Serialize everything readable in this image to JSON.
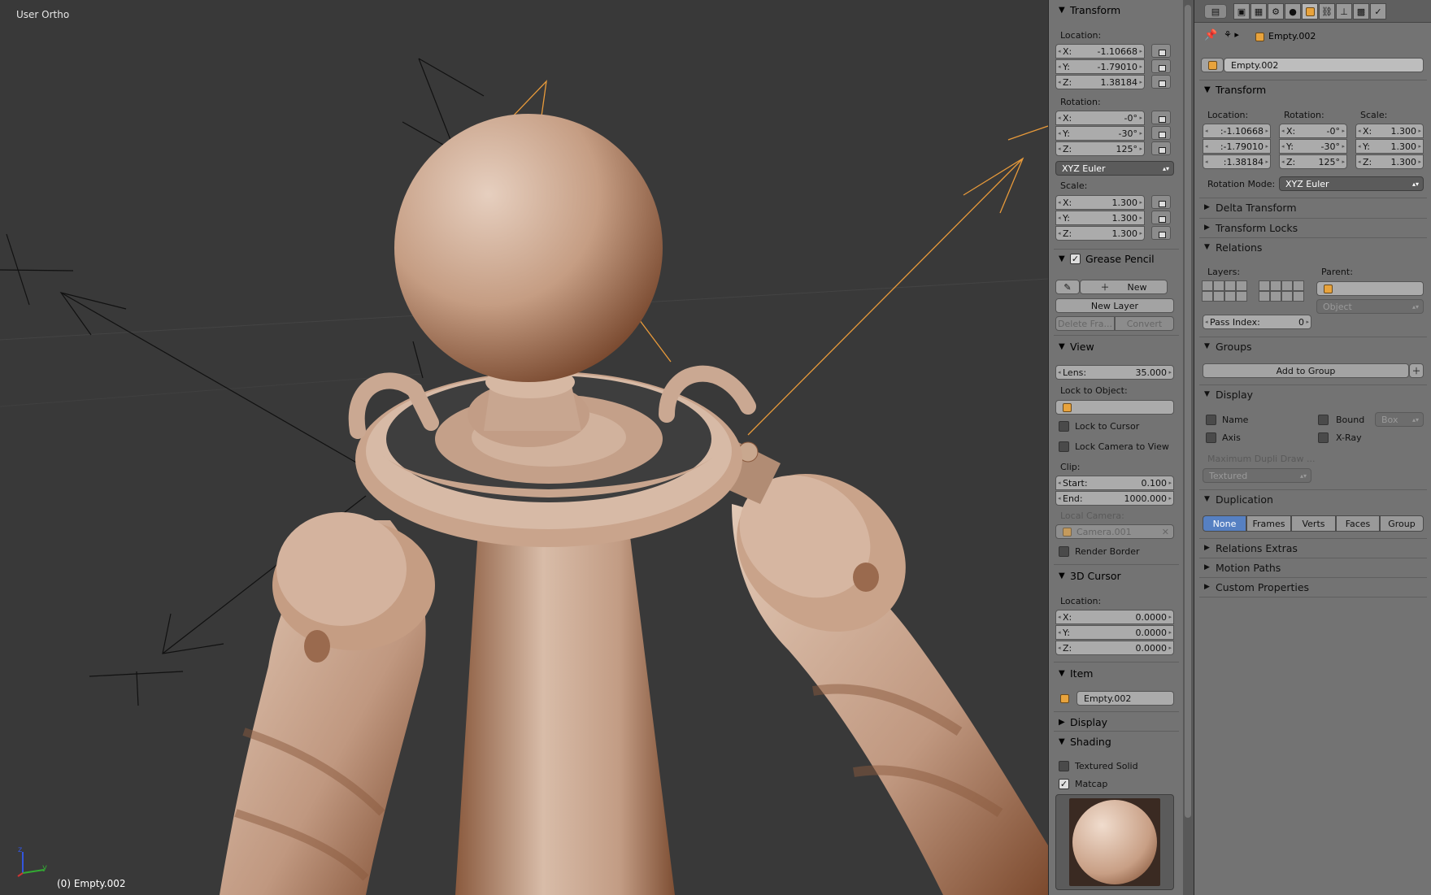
{
  "viewport": {
    "title": "User Ortho",
    "status": "(0) Empty.002",
    "axis_y": "y",
    "axis_z": "z"
  },
  "npanel": {
    "transform": {
      "header": "Transform",
      "location_label": "Location:",
      "location": [
        {
          "k": "X:",
          "v": "-1.10668"
        },
        {
          "k": "Y:",
          "v": "-1.79010"
        },
        {
          "k": "Z:",
          "v": "1.38184"
        }
      ],
      "rotation_label": "Rotation:",
      "rotation": [
        {
          "k": "X:",
          "v": "-0°"
        },
        {
          "k": "Y:",
          "v": "-30°"
        },
        {
          "k": "Z:",
          "v": "125°"
        }
      ],
      "rotation_mode": "XYZ Euler",
      "scale_label": "Scale:",
      "scale": [
        {
          "k": "X:",
          "v": "1.300"
        },
        {
          "k": "Y:",
          "v": "1.300"
        },
        {
          "k": "Z:",
          "v": "1.300"
        }
      ]
    },
    "grease_pencil": {
      "header": "Grease Pencil",
      "enabled": true,
      "new": "New",
      "new_layer": "New Layer",
      "delete_frame": "Delete Fra...",
      "convert": "Convert"
    },
    "view": {
      "header": "View",
      "lens_key": "Lens:",
      "lens_value": "35.000",
      "lock_to_object": "Lock to Object:",
      "lock_to_cursor": "Lock to Cursor",
      "lock_camera_to_view": "Lock Camera to View",
      "clip_label": "Clip:",
      "start_key": "Start:",
      "start_value": "0.100",
      "end_key": "End:",
      "end_value": "1000.000",
      "local_camera": "Local Camera:",
      "camera_name": "Camera.001",
      "render_border": "Render Border"
    },
    "cursor": {
      "header": "3D Cursor",
      "location_label": "Location:",
      "location": [
        {
          "k": "X:",
          "v": "0.0000"
        },
        {
          "k": "Y:",
          "v": "0.0000"
        },
        {
          "k": "Z:",
          "v": "0.0000"
        }
      ]
    },
    "item": {
      "header": "Item",
      "name": "Empty.002"
    },
    "display": {
      "header": "Display"
    },
    "shading": {
      "header": "Shading",
      "textured_solid": "Textured Solid",
      "matcap": "Matcap",
      "matcap_enabled": true
    }
  },
  "props": {
    "breadcrumb_object": "Empty.002",
    "object_name": "Empty.002",
    "transform": {
      "header": "Transform",
      "location_label": "Location:",
      "rotation_label": "Rotation:",
      "scale_label": "Scale:",
      "location": [
        ":-1.10668",
        ":-1.79010",
        ":1.38184"
      ],
      "rotation": [
        {
          "k": "X:",
          "v": "-0°"
        },
        {
          "k": "Y:",
          "v": "-30°"
        },
        {
          "k": "Z:",
          "v": "125°"
        }
      ],
      "scale": [
        {
          "k": "X:",
          "v": "1.300"
        },
        {
          "k": "Y:",
          "v": "1.300"
        },
        {
          "k": "Z:",
          "v": "1.300"
        }
      ],
      "rotation_mode_label": "Rotation Mode:",
      "rotation_mode": "XYZ Euler"
    },
    "delta_transform": "Delta Transform",
    "transform_locks": "Transform Locks",
    "relations": {
      "header": "Relations",
      "layers_label": "Layers:",
      "parent_label": "Parent:",
      "parent_type": "Object",
      "pass_index_key": "Pass Index:",
      "pass_index_value": "0"
    },
    "groups": {
      "header": "Groups",
      "add_to_group": "Add to Group"
    },
    "display": {
      "header": "Display",
      "name": "Name",
      "bound": "Bound",
      "bound_type": "Box",
      "axis": "Axis",
      "xray": "X-Ray",
      "max_dupli": "Maximum Dupli Draw ...",
      "draw_type": "Textured"
    },
    "duplication": {
      "header": "Duplication",
      "options": [
        "None",
        "Frames",
        "Verts",
        "Faces",
        "Group"
      ],
      "active": "None"
    },
    "relations_extras": "Relations Extras",
    "motion_paths": "Motion Paths",
    "custom_properties": "Custom Properties"
  },
  "colors": {
    "viewport_bg": "#393939",
    "panel_bg": "#737373",
    "model": "#c9a48c",
    "empty_selected": "#e89a3a",
    "active_button": "#5680c2"
  }
}
